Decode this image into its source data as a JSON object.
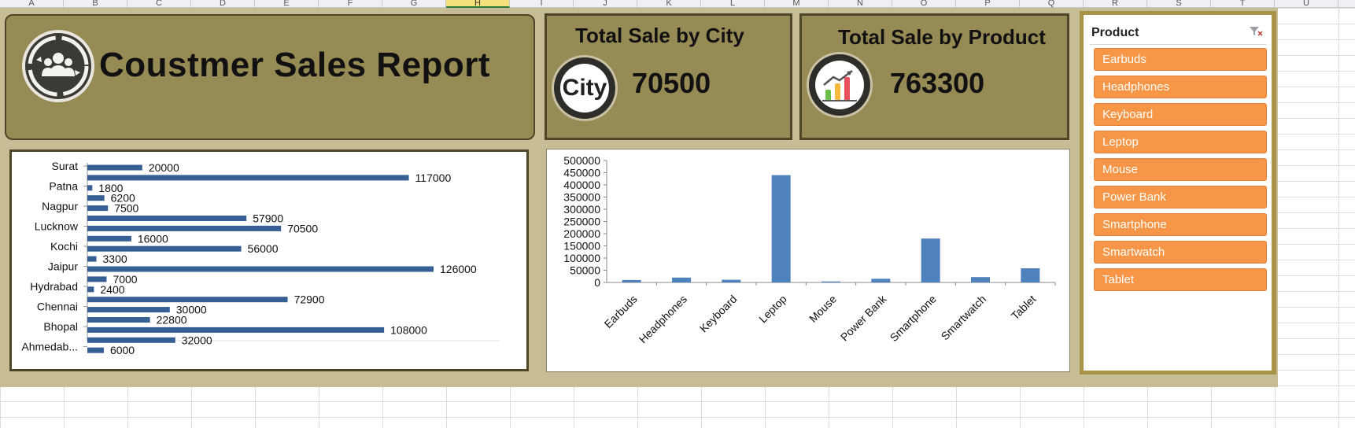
{
  "spreadsheet": {
    "columns": [
      "A",
      "B",
      "C",
      "D",
      "E",
      "F",
      "G",
      "H",
      "I",
      "J",
      "K",
      "L",
      "M",
      "N",
      "O",
      "P",
      "Q",
      "R",
      "S",
      "T",
      "U"
    ],
    "selected_column": "H"
  },
  "dashboard": {
    "title": "Coustmer Sales Report",
    "kpis": {
      "city": {
        "title": "Total Sale by City",
        "value": "70500",
        "icon": "city-icon",
        "icon_text": "City"
      },
      "product": {
        "title": "Total Sale by Product",
        "value": "763300",
        "icon": "growth-chart-icon"
      }
    },
    "colors": {
      "panel": "#968a55",
      "panel_border": "#4d4728",
      "dashboard_bg": "#c7bd95",
      "bar": "#365f93",
      "column": "#4f81bd",
      "slicer_item": "#f79646",
      "slicer_border": "#a89247"
    }
  },
  "slicer": {
    "title": "Product",
    "clear_icon": "clear-filter-icon",
    "items": [
      "Earbuds",
      "Headphones",
      "Keyboard",
      "Leptop",
      "Mouse",
      "Power Bank",
      "Smartphone",
      "Smartwatch",
      "Tablet"
    ]
  },
  "chart_data": [
    {
      "type": "bar",
      "orientation": "horizontal",
      "city_labels": [
        "Surat",
        "Patna",
        "Nagpur",
        "Lucknow",
        "Kochi",
        "Jaipur",
        "Hydrabad",
        "Chennai",
        "Bhopal",
        "Ahmedab..."
      ],
      "values_top_to_bottom": [
        20000,
        117000,
        1800,
        6200,
        7500,
        57900,
        70500,
        16000,
        56000,
        3300,
        126000,
        7000,
        2400,
        72900,
        30000,
        22800,
        108000,
        32000,
        6000
      ],
      "data_labels": true,
      "grid": false,
      "legend": "none"
    },
    {
      "type": "bar",
      "orientation": "vertical",
      "categories": [
        "Earbuds",
        "Headphones",
        "Keyboard",
        "Leptop",
        "Mouse",
        "Power Bank",
        "Smartphone",
        "Smartwatch",
        "Tablet"
      ],
      "values": [
        10000,
        20000,
        11000,
        440000,
        4000,
        15000,
        180000,
        22000,
        58000
      ],
      "ylim": [
        0,
        500000
      ],
      "yticks": [
        "0",
        "50000",
        "100000",
        "150000",
        "200000",
        "250000",
        "300000",
        "350000",
        "400000",
        "450000",
        "500000"
      ],
      "grid": false,
      "legend": "none"
    }
  ]
}
